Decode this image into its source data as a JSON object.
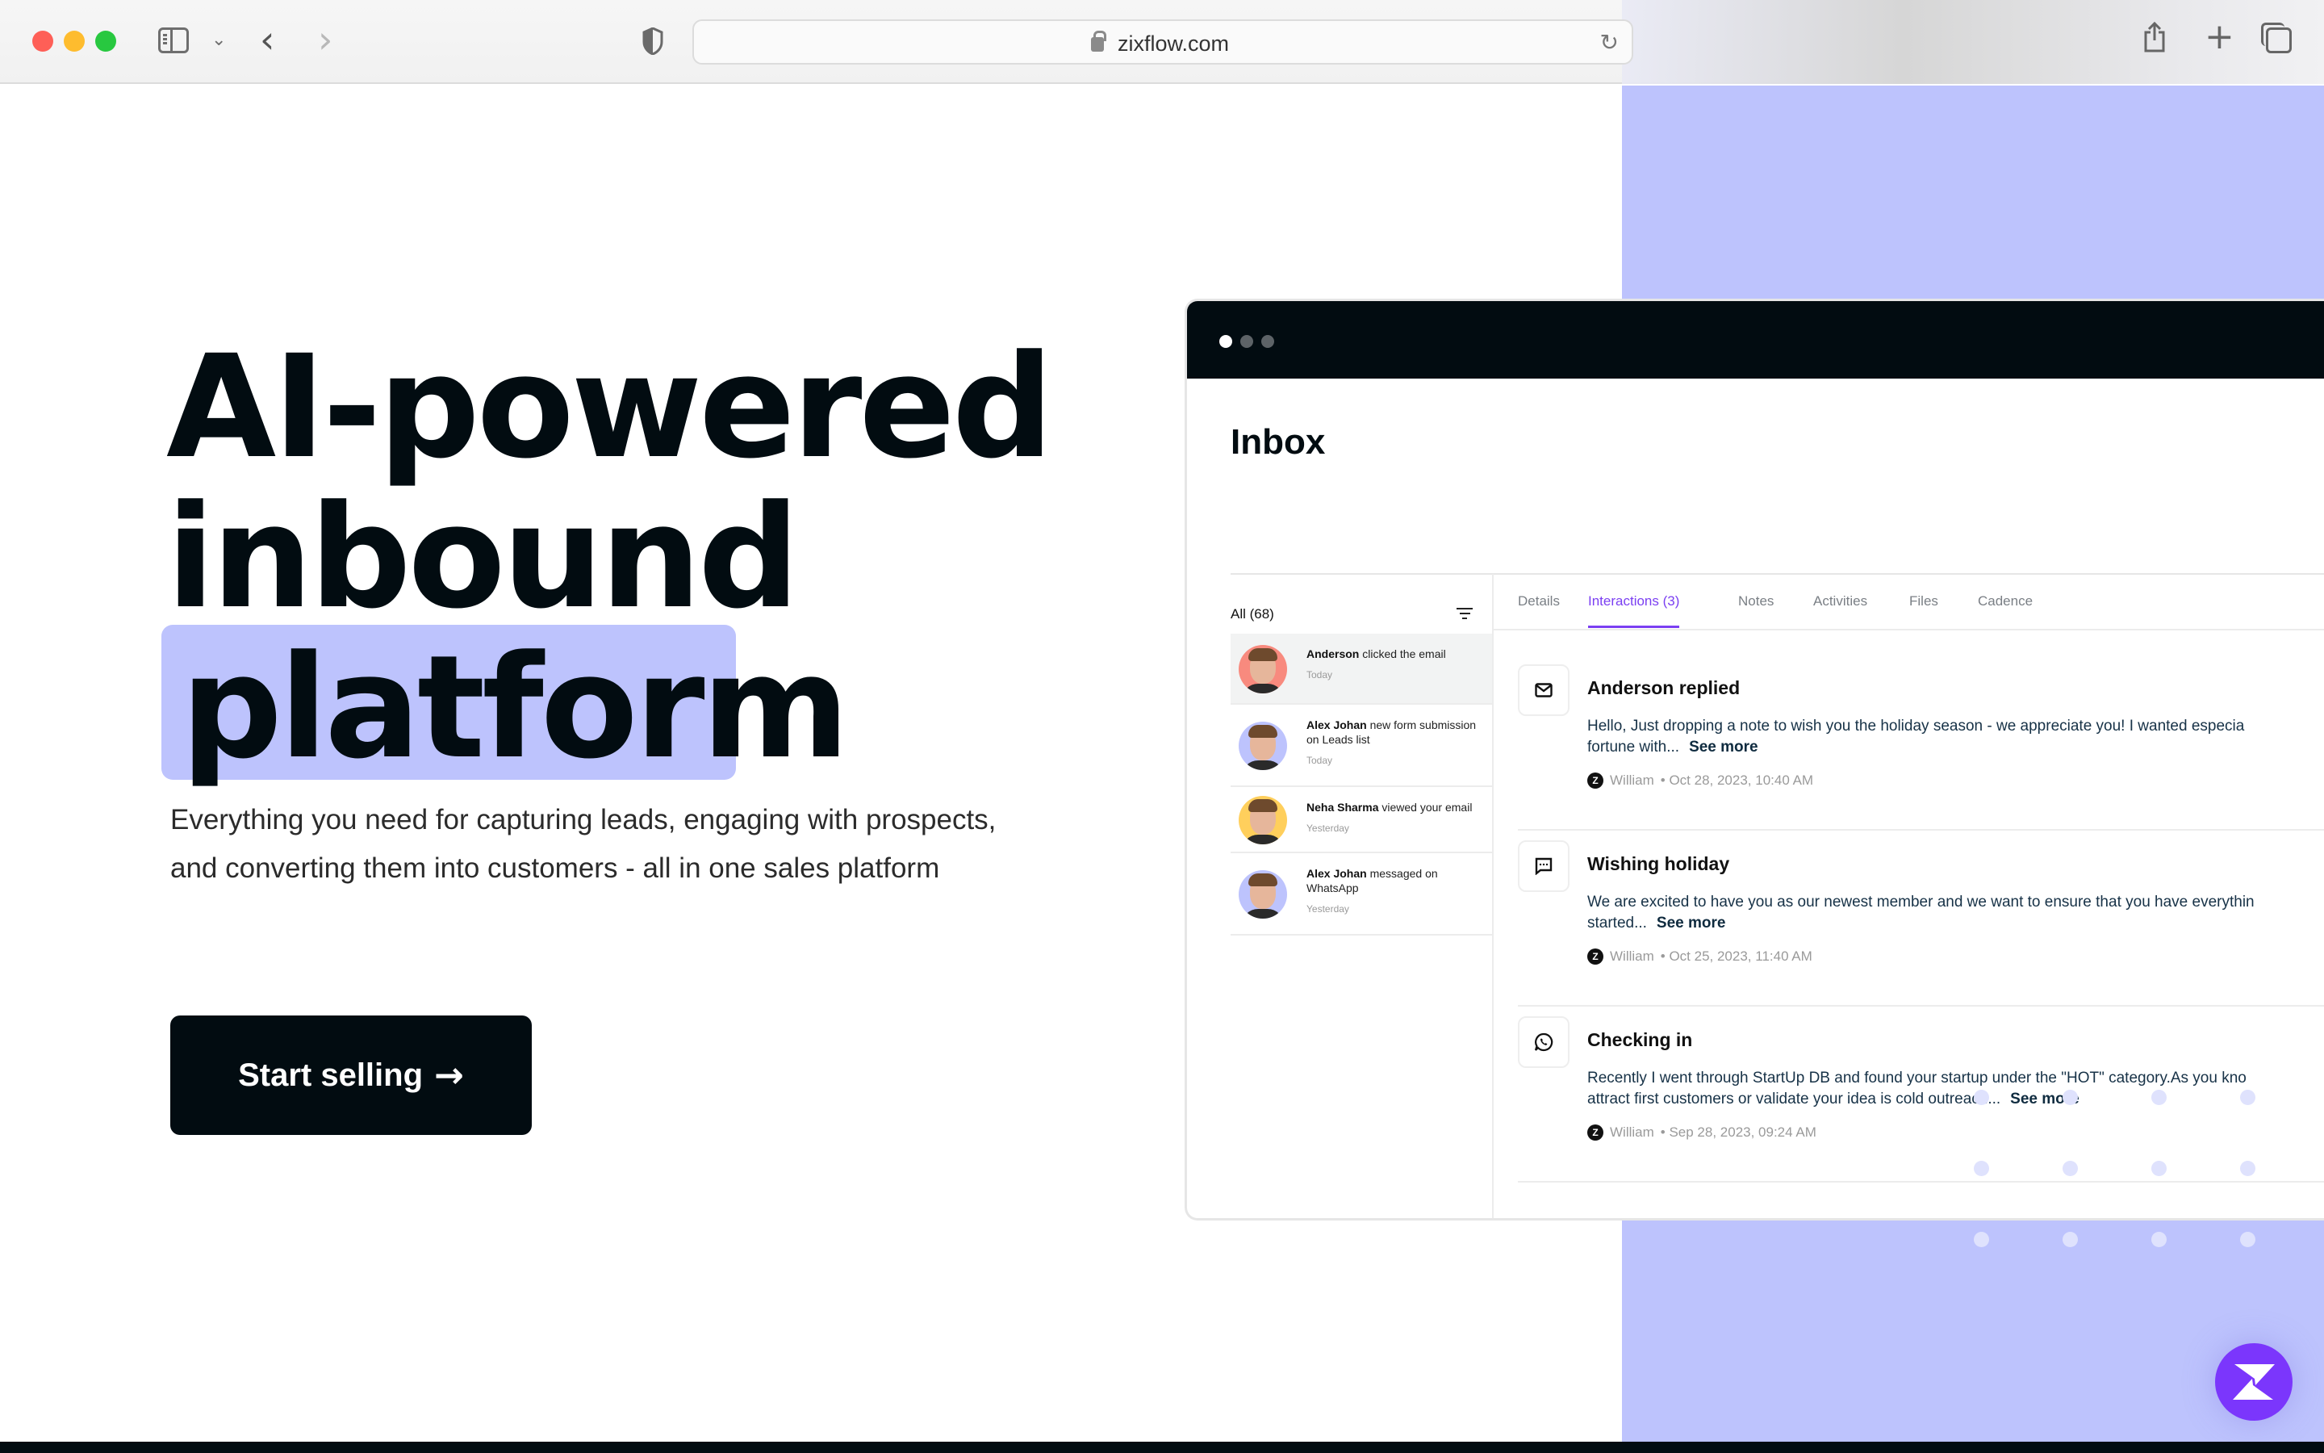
{
  "browser": {
    "url": "zixflow.com",
    "icons": [
      "sidebar-toggle-icon",
      "chevron-down-icon",
      "back-icon",
      "forward-icon",
      "privacy-shield-icon",
      "lock-icon",
      "reload-icon",
      "share-icon",
      "new-tab-icon",
      "tab-overview-icon"
    ]
  },
  "hero": {
    "title_lines": [
      "AI-powered",
      "inbound",
      "platform"
    ],
    "highlighted_word": "platform",
    "subtitle": "Everything you need for capturing leads, engaging with prospects, and converting them into customers - all in one sales platform",
    "cta_label": "Start selling",
    "cta_arrow": "→"
  },
  "inbox": {
    "title": "Inbox",
    "list_header": "All (68)",
    "items": [
      {
        "name": "Anderson",
        "action": "clicked the email",
        "time": "Today",
        "avatar_bg": "#f88a7e",
        "active": true
      },
      {
        "name": "Alex Johan",
        "action": "new form submission on Leads list",
        "time": "Today",
        "avatar_bg": "#bdc3fd",
        "active": false
      },
      {
        "name": "Neha Sharma",
        "action": "viewed your email",
        "time": "Yesterday",
        "avatar_bg": "#ffcf5c",
        "active": false
      },
      {
        "name": "Alex Johan",
        "action": "messaged on WhatsApp",
        "time": "Yesterday",
        "avatar_bg": "#bdc3fd",
        "active": false
      }
    ],
    "tabs": [
      {
        "label": "Details",
        "active": false
      },
      {
        "label": "Interactions (3)",
        "active": true
      },
      {
        "label": "Notes",
        "active": false
      },
      {
        "label": "Activities",
        "active": false
      },
      {
        "label": "Files",
        "active": false
      },
      {
        "label": "Cadence",
        "active": false
      }
    ],
    "interactions": [
      {
        "icon": "mail-icon",
        "title": "Anderson replied",
        "body_line1": "Hello, Just dropping a note to wish you the holiday season - we appreciate you!  I wanted especia",
        "body_line2": "fortune with...",
        "see_more": "See more",
        "author": "William",
        "date": "• Oct 28, 2023, 10:40 AM"
      },
      {
        "icon": "chat-icon",
        "title": "Wishing holiday",
        "body_line1": "We are excited to have you as our newest member and we want to ensure that you have everythin",
        "body_line2": "started...",
        "see_more": "See more",
        "author": "William",
        "date": "• Oct 25, 2023, 11:40 AM"
      },
      {
        "icon": "whatsapp-icon",
        "title": "Checking in",
        "body_line1": "Recently I went through StartUp DB and found your startup under the \"HOT\" category.As you kno",
        "body_line2": "attract first customers or validate your idea is cold outreach...",
        "see_more": "See more",
        "author": "William",
        "date": "• Sep 28, 2023, 09:24 AM"
      }
    ]
  },
  "colors": {
    "brand_dark": "#020c11",
    "accent_purple": "#7b3ff2",
    "lavender": "#bdc3fd",
    "green": "#77d195",
    "fab": "#7b36fc"
  },
  "fab": {
    "label": "Z",
    "icon": "zixflow-logo-icon"
  }
}
